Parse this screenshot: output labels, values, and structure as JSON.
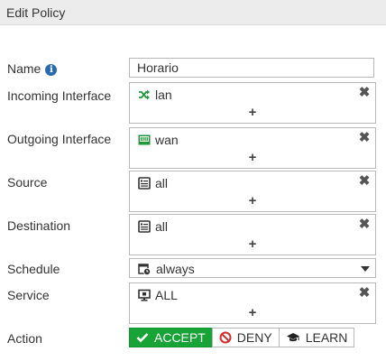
{
  "header": {
    "title": "Edit Policy"
  },
  "labels": {
    "name": "Name",
    "incoming": "Incoming Interface",
    "outgoing": "Outgoing Interface",
    "source": "Source",
    "destination": "Destination",
    "schedule": "Schedule",
    "service": "Service",
    "action": "Action"
  },
  "name_field": {
    "value": "Horario"
  },
  "incoming": {
    "value": "lan",
    "icon": "cross-arrows-icon",
    "add": "+",
    "remove": "✖"
  },
  "outgoing": {
    "value": "wan",
    "icon": "wan-port-icon",
    "add": "+",
    "remove": "✖"
  },
  "source": {
    "value": "all",
    "icon": "address-icon",
    "add": "+",
    "remove": "✖"
  },
  "destination": {
    "value": "all",
    "icon": "address-icon",
    "add": "+",
    "remove": "✖"
  },
  "schedule": {
    "value": "always",
    "icon": "calendar-clock-icon"
  },
  "service": {
    "value": "ALL",
    "icon": "monitor-icon",
    "add": "+",
    "remove": "✖"
  },
  "action": {
    "accept": "ACCEPT",
    "deny": "DENY",
    "learn": "LEARN",
    "selected": "accept"
  },
  "colors": {
    "accept_green": "#18a337",
    "info_blue": "#2a6bb0",
    "interface_green": "#1c9a3a",
    "deny_red": "#d62b2b"
  }
}
